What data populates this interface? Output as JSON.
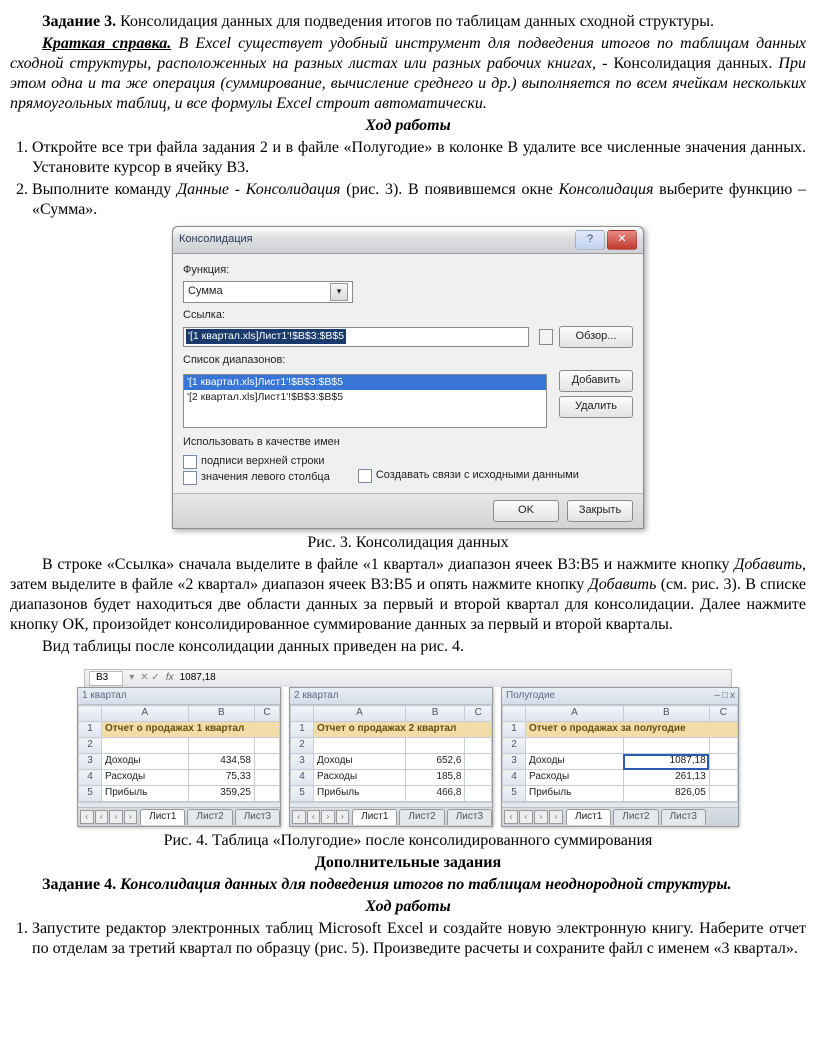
{
  "p1a": "Задание 3.",
  "p1b": " Консолидация данных для подведения итогов по таблицам данных сходной структуры.",
  "p2a": "Краткая справка.",
  "p2b": " В Excel существует удобный инструмент для подведения итогов по таблицам данных сходной структуры, расположенных на разных листах или разных рабочих книгах, - ",
  "p2c": "Консолидация данных.",
  "p2d": " При этом одна и та же операция (суммирование, вычисление среднего и др.) выполняется по всем ячейкам нескольких прямоугольных таблиц, и все формулы Excel строит автоматически.",
  "h_work1": "Ход работы",
  "li1": "Откройте все три файла задания 2 и в файле «Полугодие» в колонке В удалите все численные значения данных. Установите курсор в ячейку В3.",
  "li2a": "Выполните команду ",
  "li2b": "Данные - Консолидация",
  "li2c": " (рис. 3). В появившемся окне ",
  "li2d": "Консолидация",
  "li2e": " выберите функцию – «Сумма».",
  "dlg": {
    "title": "Консолидация",
    "lbl_func": "Функция:",
    "func": "Сумма",
    "lbl_ref": "Ссылка:",
    "ref_val": "'[1 квартал.xls]Лист1'!$B$3:$B$5",
    "btn_browse": "Обзор...",
    "lbl_list": "Список диапазонов:",
    "list1": "'[1 квартал.xls]Лист1'!$B$3:$B$5",
    "list2": "'[2 квартал.xls]Лист1'!$B$3:$B$5",
    "btn_add": "Добавить",
    "btn_del": "Удалить",
    "lbl_use": "Использовать в качестве имен",
    "chk_top": "подписи верхней строки",
    "chk_left": "значения левого столбца",
    "chk_link": "Создавать связи с исходными данными",
    "btn_ok": "OK",
    "btn_close": "Закрыть"
  },
  "cap3": "Рис. 3. Консолидация данных",
  "p3a": "В строке «Ссылка» сначала выделите в файле «1 квартал» диапазон ячеек В3:В5 и нажмите кнопку ",
  "p3b": "Добавить",
  "p3c": ", затем выделите в файле «2 квартал» диапазон ячеек В3:В5 и опять нажмите кнопку ",
  "p3d": "Добавить",
  "p3e": " (см. рис. 3). В списке диапазонов будет находиться две области данных за первый и второй квартал для консолидации. Далее нажмите кнопку ОК, произойдет консолидированное суммирование данных за первый и второй кварталы.",
  "p4": "Вид таблицы после консолидации данных приведен на рис. 4.",
  "xl": {
    "cellref": "B3",
    "fx": "fx",
    "val": "1087,18",
    "tabs": [
      "Лист1",
      "Лист2",
      "Лист3"
    ],
    "panel1": {
      "title": "1 квартал",
      "merged": "Отчет о продажах 1 квартал",
      "rows": [
        [
          "Доходы",
          "434,58"
        ],
        [
          "Расходы",
          "75,33"
        ],
        [
          "Прибыль",
          "359,25"
        ]
      ]
    },
    "panel2": {
      "title": "2 квартал",
      "merged": "Отчет о продажах 2 квартал",
      "rows": [
        [
          "Доходы",
          "652,6"
        ],
        [
          "Расходы",
          "185,8"
        ],
        [
          "Прибыль",
          "466,8"
        ]
      ]
    },
    "panel3": {
      "title": "Полугодие",
      "merged": "Отчет о продажах за полугодие",
      "rows": [
        [
          "Доходы",
          "1087,18"
        ],
        [
          "Расходы",
          "261,13"
        ],
        [
          "Прибыль",
          "826,05"
        ]
      ]
    }
  },
  "cap4": "Рис. 4. Таблица «Полугодие» после консолидированного суммирования",
  "h_extra": "Дополнительные задания",
  "p5a": "Задание 4.",
  "p5b": " Консолидация данных для подведения итогов по таблицам неоднородной структуры.",
  "h_work2": "Ход работы",
  "li3": "Запустите редактор электронных таблиц Microsoft Excel и создайте новую электронную книгу. Наберите отчет по отделам за третий квартал по образцу (рис. 5). Произведите расчеты и сохраните файл с именем «3 квартал»."
}
